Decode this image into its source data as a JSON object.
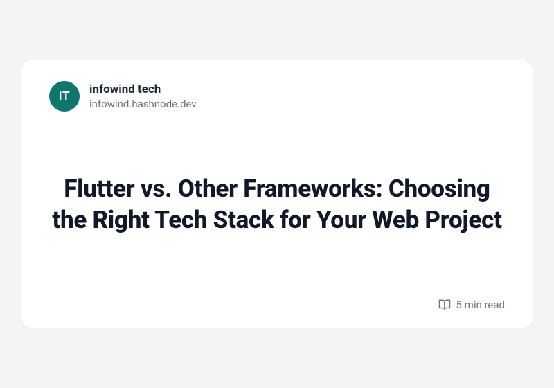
{
  "author": {
    "initials": "IT",
    "name": "infowind tech",
    "domain": "infowind.hashnode.dev"
  },
  "title": "Flutter vs. Other Frameworks: Choosing the Right Tech Stack for Your Web Project",
  "readTime": "5 min read"
}
